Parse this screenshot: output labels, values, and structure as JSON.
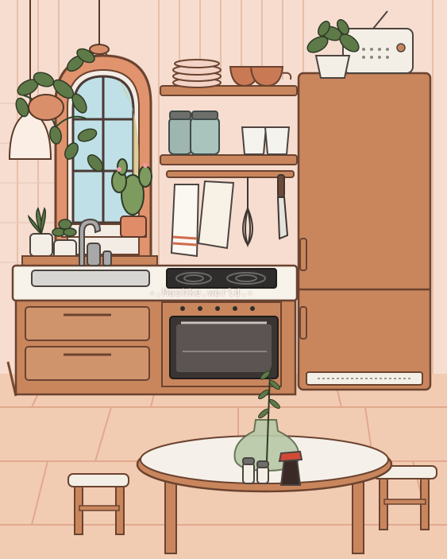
{
  "scene": {
    "watermark": "✧.Mashke.world.✧",
    "colors": {
      "wall": "#f6ddd0",
      "wall_stripe": "#e9c2ad",
      "wood": "#c9865d",
      "wood_dark": "#7a4a2e",
      "counter_top": "#f7f2ea",
      "floor": "#f2cbb3",
      "table_top": "#f5f1ea",
      "plant_green": "#5e7a48"
    },
    "objects": [
      "hanging-plant",
      "pendant-lamp",
      "arched-window",
      "potted-cactus",
      "succulent-pots",
      "wall-shelf",
      "stacked-plates",
      "bowls",
      "glass-jars",
      "drinking-glasses",
      "hanging-towels",
      "whisk",
      "kitchen-knife",
      "sink",
      "faucet",
      "stovetop",
      "oven",
      "kitchen-drawers",
      "refrigerator",
      "radio",
      "fridge-plant",
      "dining-table",
      "vase-with-branch",
      "salt-pepper-shakers",
      "soy-sauce-bottle",
      "stool-left",
      "stool-right"
    ]
  }
}
